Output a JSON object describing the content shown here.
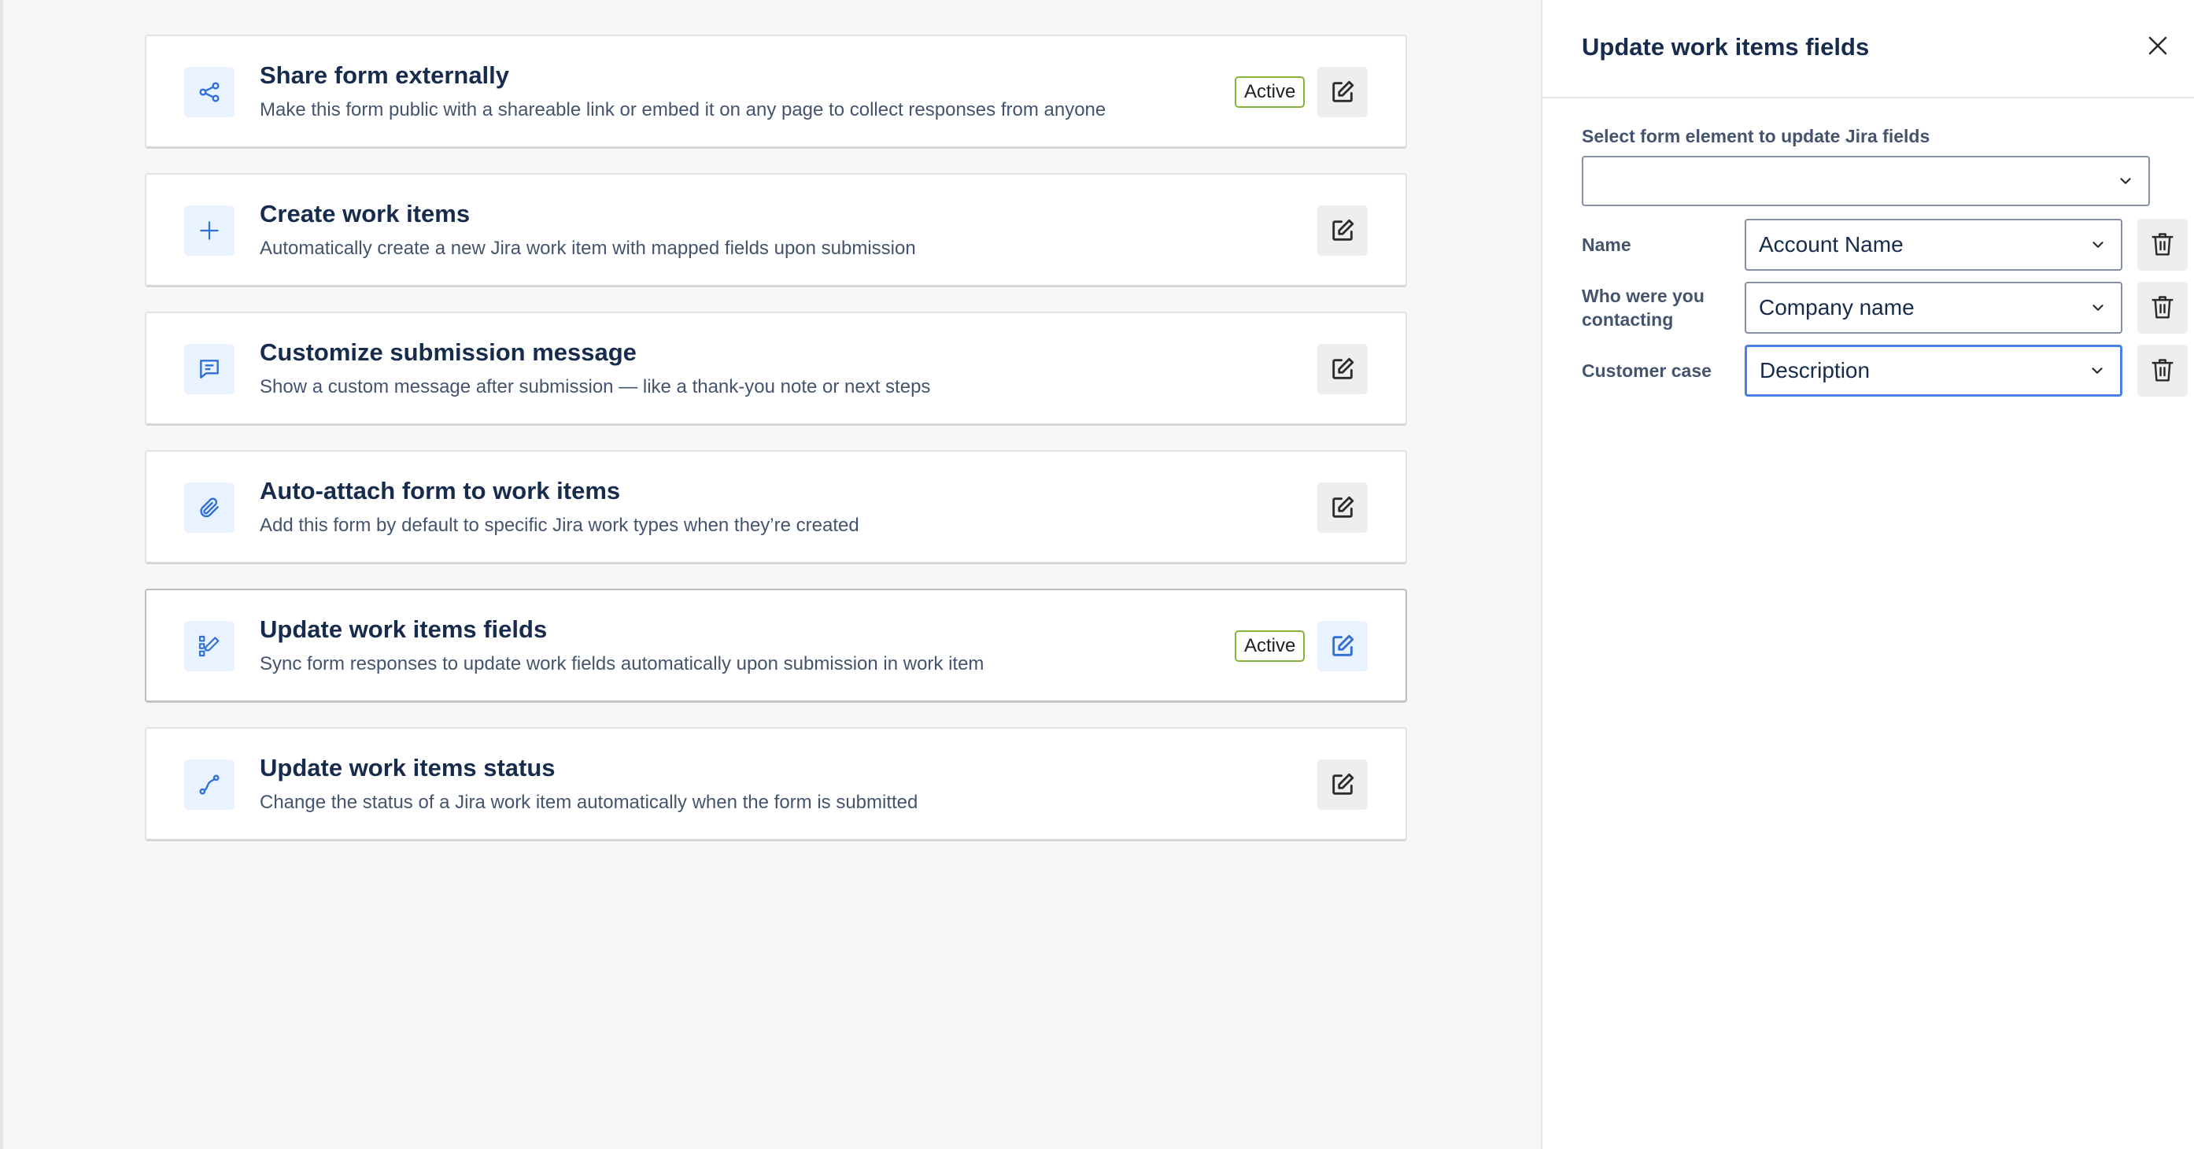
{
  "colors": {
    "accent": "#2f6fd8",
    "active_border": "#82b536",
    "icon_bg": "#e9f2ff",
    "focus_border": "#4c7ee8"
  },
  "features": [
    {
      "icon": "share-icon",
      "title": "Share form externally",
      "description": "Make this form public with a shareable link or embed it on any page to collect responses from anyone",
      "badge": "Active"
    },
    {
      "icon": "plus-icon",
      "title": "Create work items",
      "description": "Automatically create a new Jira work item with mapped fields upon submission",
      "badge": ""
    },
    {
      "icon": "message-icon",
      "title": "Customize submission message",
      "description": "Show a custom message after submission — like a thank-you note or next steps",
      "badge": ""
    },
    {
      "icon": "paperclip-icon",
      "title": "Auto-attach form to work items",
      "description": "Add this form by default to specific Jira work types when they’re created",
      "badge": ""
    },
    {
      "icon": "fields-edit-icon",
      "title": "Update work items fields",
      "description": "Sync form responses to update work fields automatically upon submission in work item",
      "badge": "Active"
    },
    {
      "icon": "status-path-icon",
      "title": "Update work items status",
      "description": "Change the status of a Jira work item automatically when the form is submitted",
      "badge": ""
    }
  ],
  "panel": {
    "title": "Update work items fields",
    "select_label": "Select form element to update Jira fields",
    "select_value": "",
    "mappings": [
      {
        "label": "Name",
        "value": "Account Name"
      },
      {
        "label": "Who were you contacting",
        "value": "Company name"
      },
      {
        "label": "Customer case",
        "value": "Description"
      }
    ]
  }
}
